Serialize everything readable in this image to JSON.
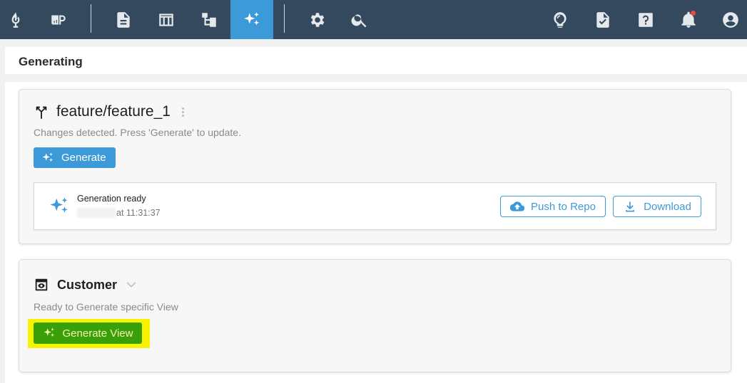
{
  "toolbar": {
    "items": [
      {
        "icon": "app-logo-icon",
        "label": ""
      },
      {
        "icon": "project-icon",
        "label": ""
      },
      {
        "icon": "document-icon",
        "label": ""
      },
      {
        "icon": "table-icon",
        "label": ""
      },
      {
        "icon": "hierarchy-icon",
        "label": ""
      },
      {
        "icon": "sparkles-icon",
        "label": "",
        "active": true
      },
      {
        "icon": "gear-icon",
        "label": ""
      },
      {
        "icon": "search-icon",
        "label": ""
      },
      {
        "icon": "lightbulb-icon",
        "label": ""
      },
      {
        "icon": "document-check-icon",
        "label": ""
      },
      {
        "icon": "help-icon",
        "label": ""
      },
      {
        "icon": "bell-icon",
        "label": ""
      },
      {
        "icon": "user-account-icon",
        "label": ""
      }
    ],
    "accent_color": "#3d9ad9",
    "bar_color": "#34495e"
  },
  "page": {
    "title": "Generating"
  },
  "branch_card": {
    "branch_name": "feature/feature_1",
    "status_message": "Changes detected. Press 'Generate' to update.",
    "generate_button": "Generate",
    "generation": {
      "status": "Generation ready",
      "time": "at 11:31:37",
      "push_button": "Push to Repo",
      "download_button": "Download"
    }
  },
  "view_card": {
    "view_name": "Customer",
    "status_message": "Ready to Generate specific View",
    "generate_view_button": "Generate View",
    "highlight_color": "#f8f400",
    "button_color": "#3aa00a"
  }
}
